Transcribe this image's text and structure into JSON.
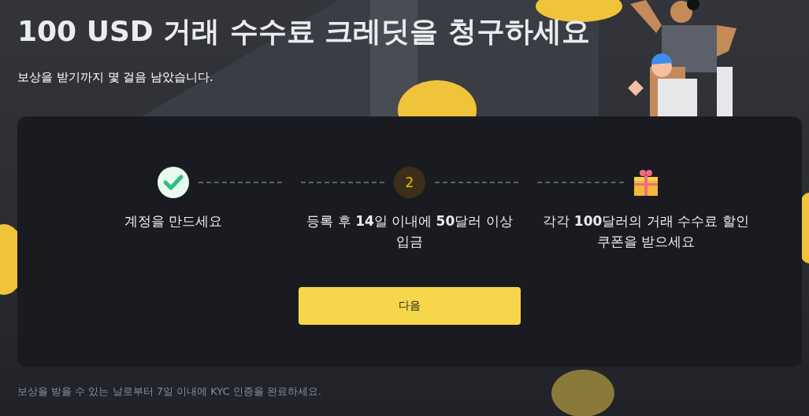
{
  "title": "100 USD 거래 수수료 크레딧을 청구하세요",
  "subtitle": "보상을 받기까지 몇 걸음 남았습니다.",
  "steps": [
    {
      "kind": "done",
      "label": "계정을 만드세요"
    },
    {
      "kind": "current",
      "marker": "2",
      "label": "등록 후 **14**일 이내에 **50**달러 이상 입금"
    },
    {
      "kind": "reward",
      "label": "각각 **100**달러의 거래 수수료 할인 쿠폰을 받으세요"
    }
  ],
  "next_button": "다음",
  "footnote": "보상을 받을 수 있는 날로부터 7일 이내에 KYC 인증을 완료하세요."
}
